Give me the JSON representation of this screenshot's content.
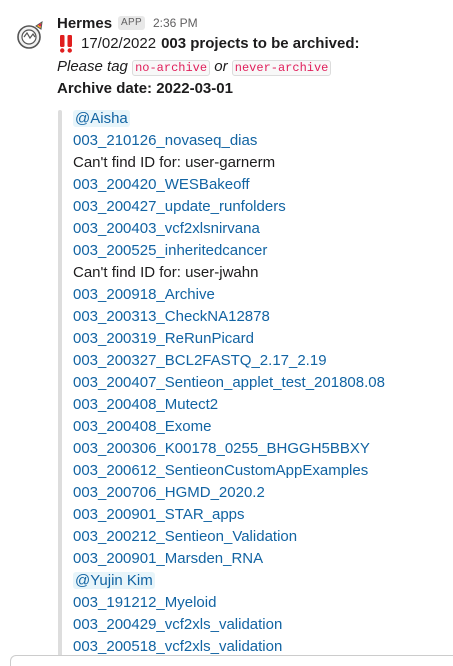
{
  "message": {
    "sender": "Hermes",
    "badge": "APP",
    "time": "2:36 PM",
    "title_date": "17/02/2022",
    "title_bold": "003 projects to be archived:",
    "tag_prefix": "Please tag",
    "tag_code_1": "no-archive",
    "tag_or": "or",
    "tag_code_2": "never-archive",
    "archive_date": "Archive date: 2022-03-01"
  },
  "items": [
    {
      "text": "@Aisha",
      "kind": "mention"
    },
    {
      "text": "003_210126_novaseq_dias",
      "kind": "link"
    },
    {
      "text": "Can't find ID for: user-garnerm",
      "kind": "plain"
    },
    {
      "text": "003_200420_WESBakeoff",
      "kind": "link"
    },
    {
      "text": "003_200427_update_runfolders",
      "kind": "link"
    },
    {
      "text": "003_200403_vcf2xlsnirvana",
      "kind": "link"
    },
    {
      "text": "003_200525_inheritedcancer",
      "kind": "link"
    },
    {
      "text": "Can't find ID for: user-jwahn",
      "kind": "plain"
    },
    {
      "text": "003_200918_Archive",
      "kind": "link"
    },
    {
      "text": "003_200313_CheckNA12878",
      "kind": "link"
    },
    {
      "text": "003_200319_ReRunPicard",
      "kind": "link"
    },
    {
      "text": "003_200327_BCL2FASTQ_2.17_2.19",
      "kind": "link"
    },
    {
      "text": "003_200407_Sentieon_applet_test_201808.08",
      "kind": "link"
    },
    {
      "text": "003_200408_Mutect2",
      "kind": "link"
    },
    {
      "text": "003_200408_Exome",
      "kind": "link"
    },
    {
      "text": "003_200306_K00178_0255_BHGGH5BBXY",
      "kind": "link"
    },
    {
      "text": "003_200612_SentieonCustomAppExamples",
      "kind": "link"
    },
    {
      "text": "003_200706_HGMD_2020.2",
      "kind": "link"
    },
    {
      "text": "003_200901_STAR_apps",
      "kind": "link"
    },
    {
      "text": "003_200212_Sentieon_Validation",
      "kind": "link"
    },
    {
      "text": "003_200901_Marsden_RNA",
      "kind": "link"
    },
    {
      "text": "@Yujin Kim",
      "kind": "mention"
    },
    {
      "text": "003_191212_Myeloid",
      "kind": "link"
    },
    {
      "text": "003_200429_vcf2xls_validation",
      "kind": "link"
    },
    {
      "text": "003_200518_vcf2xls_validation",
      "kind": "link"
    }
  ]
}
